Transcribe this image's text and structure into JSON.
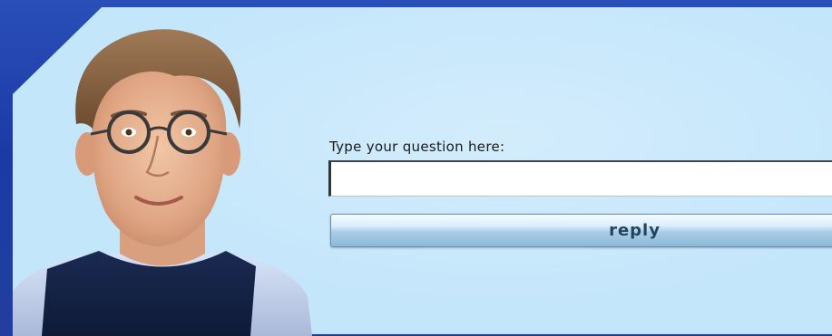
{
  "colors": {
    "frame_blue": "#1b3aa6",
    "panel_light_blue": "#c4e6fb",
    "button_text": "#24445e"
  },
  "avatar": {
    "icon": "virtual-assistant-avatar"
  },
  "question": {
    "label": "Type your question here:",
    "value": ""
  },
  "reply_button": {
    "label": "reply"
  }
}
